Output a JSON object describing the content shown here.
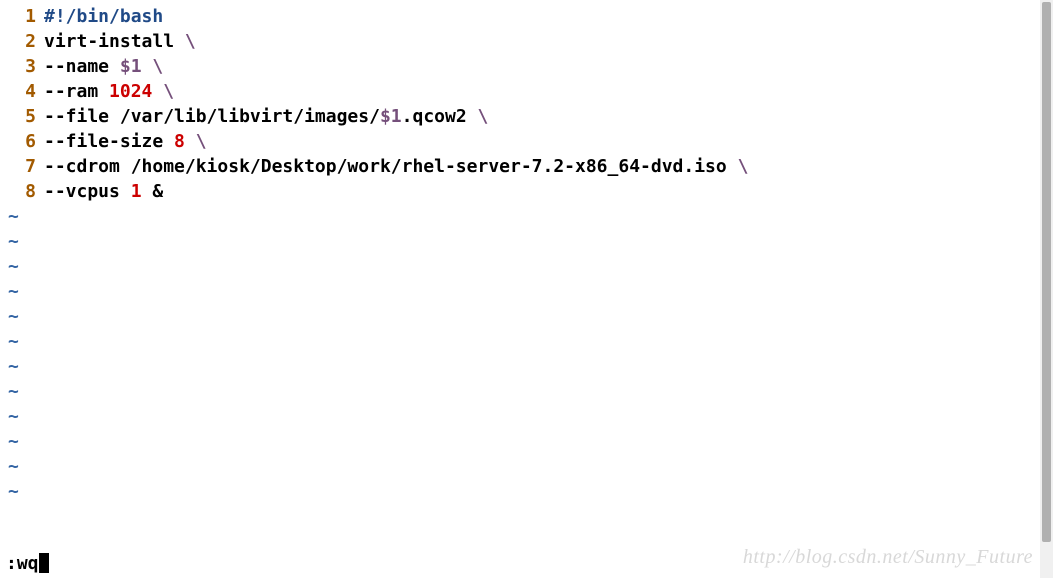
{
  "code": {
    "lines": [
      {
        "num": "1",
        "segments": [
          {
            "cls": "comment-blue",
            "text": "#!/bin/bash"
          }
        ]
      },
      {
        "num": "2",
        "segments": [
          {
            "cls": "text-black",
            "text": "virt-install "
          },
          {
            "cls": "var-purple",
            "text": "\\"
          }
        ]
      },
      {
        "num": "3",
        "segments": [
          {
            "cls": "text-black",
            "text": "--name "
          },
          {
            "cls": "var-purple",
            "text": "$1"
          },
          {
            "cls": "text-black",
            "text": " "
          },
          {
            "cls": "var-purple",
            "text": "\\"
          }
        ]
      },
      {
        "num": "4",
        "segments": [
          {
            "cls": "text-black",
            "text": "--ram "
          },
          {
            "cls": "num-red",
            "text": "1024"
          },
          {
            "cls": "text-black",
            "text": " "
          },
          {
            "cls": "var-purple",
            "text": "\\"
          }
        ]
      },
      {
        "num": "5",
        "segments": [
          {
            "cls": "text-black",
            "text": "--file /var/lib/libvirt/images/"
          },
          {
            "cls": "var-purple",
            "text": "$1"
          },
          {
            "cls": "text-black",
            "text": ".qcow2 "
          },
          {
            "cls": "var-purple",
            "text": "\\"
          }
        ]
      },
      {
        "num": "6",
        "segments": [
          {
            "cls": "text-black",
            "text": "--file-size "
          },
          {
            "cls": "num-red",
            "text": "8"
          },
          {
            "cls": "text-black",
            "text": " "
          },
          {
            "cls": "var-purple",
            "text": "\\"
          }
        ]
      },
      {
        "num": "7",
        "segments": [
          {
            "cls": "text-black",
            "text": "--cdrom /home/kiosk/Desktop/work/rhel-server-7.2-x86_64-dvd.iso "
          },
          {
            "cls": "var-purple",
            "text": "\\"
          }
        ]
      },
      {
        "num": "8",
        "segments": [
          {
            "cls": "text-black",
            "text": "--vcpus "
          },
          {
            "cls": "num-red",
            "text": "1"
          },
          {
            "cls": "text-black",
            "text": " &"
          }
        ]
      }
    ],
    "tilde_count": 12,
    "tilde_char": "~"
  },
  "cmdline": {
    "text": ":wq"
  },
  "watermark": "http://blog.csdn.net/Sunny_Future"
}
